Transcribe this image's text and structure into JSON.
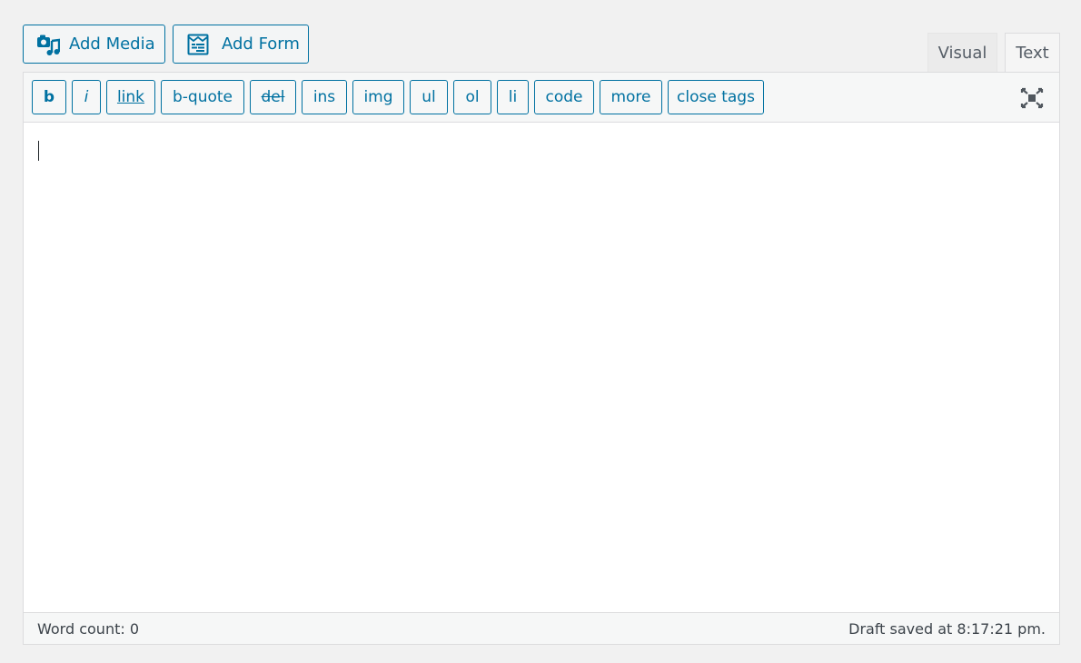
{
  "media_buttons": {
    "add_media": {
      "label": "Add Media",
      "icon": "media-icon"
    },
    "add_form": {
      "label": "Add Form",
      "icon": "form-icon"
    }
  },
  "tabs": [
    {
      "label": "Visual",
      "active": false
    },
    {
      "label": "Text",
      "active": true
    }
  ],
  "toolbar": {
    "buttons": [
      "b",
      "i",
      "link",
      "b-quote",
      "del",
      "ins",
      "img",
      "ul",
      "ol",
      "li",
      "code",
      "more",
      "close tags"
    ],
    "fullscreen_icon": "fullscreen-icon"
  },
  "editor": {
    "content": ""
  },
  "statusbar": {
    "word_count": "Word count: 0",
    "draft_status": "Draft saved at 8:17:21 pm."
  },
  "colors": {
    "accent": "#0071a1",
    "background": "#f1f1f1"
  }
}
